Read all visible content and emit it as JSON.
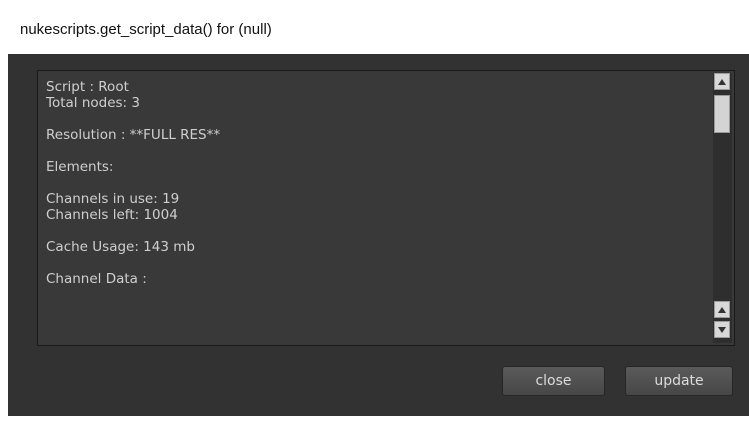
{
  "window": {
    "title": "nukescripts.get_script_data() for (null)"
  },
  "output": {
    "lines": [
      "Script : Root",
      "Total nodes: 3",
      "",
      "Resolution : **FULL RES**",
      "",
      "Elements:",
      "",
      "Channels in use: 19",
      "Channels left: 1004",
      "",
      "Cache Usage: 143 mb",
      "",
      "Channel Data :"
    ]
  },
  "buttons": {
    "close_label": "close",
    "update_label": "update"
  },
  "icons": {
    "scroll_up": "arrow-up-icon",
    "scroll_down": "arrow-down-icon"
  },
  "colors": {
    "panel_bg": "#323232",
    "text_area_bg": "#393939",
    "text_color": "#cfcfcf"
  }
}
